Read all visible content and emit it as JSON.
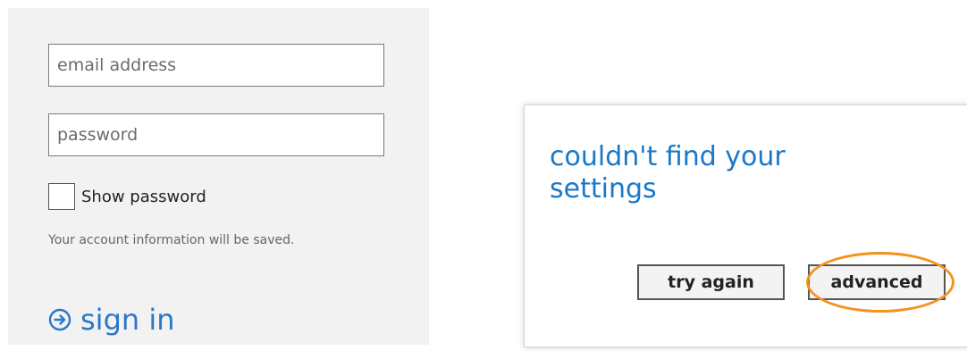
{
  "login": {
    "email_placeholder": "email address",
    "password_placeholder": "password",
    "show_password_label": "Show password",
    "account_note": "Your account information will be saved.",
    "sign_in_label": "sign in"
  },
  "dialog": {
    "title": "couldn't find your settings",
    "try_again_label": "try again",
    "advanced_label": "advanced"
  },
  "colors": {
    "accent_blue": "#2a78c8",
    "highlight_orange": "#f5921e",
    "panel_background": "#f2f2f2"
  },
  "icons": {
    "sign_in": "circle-arrow-right-icon"
  }
}
